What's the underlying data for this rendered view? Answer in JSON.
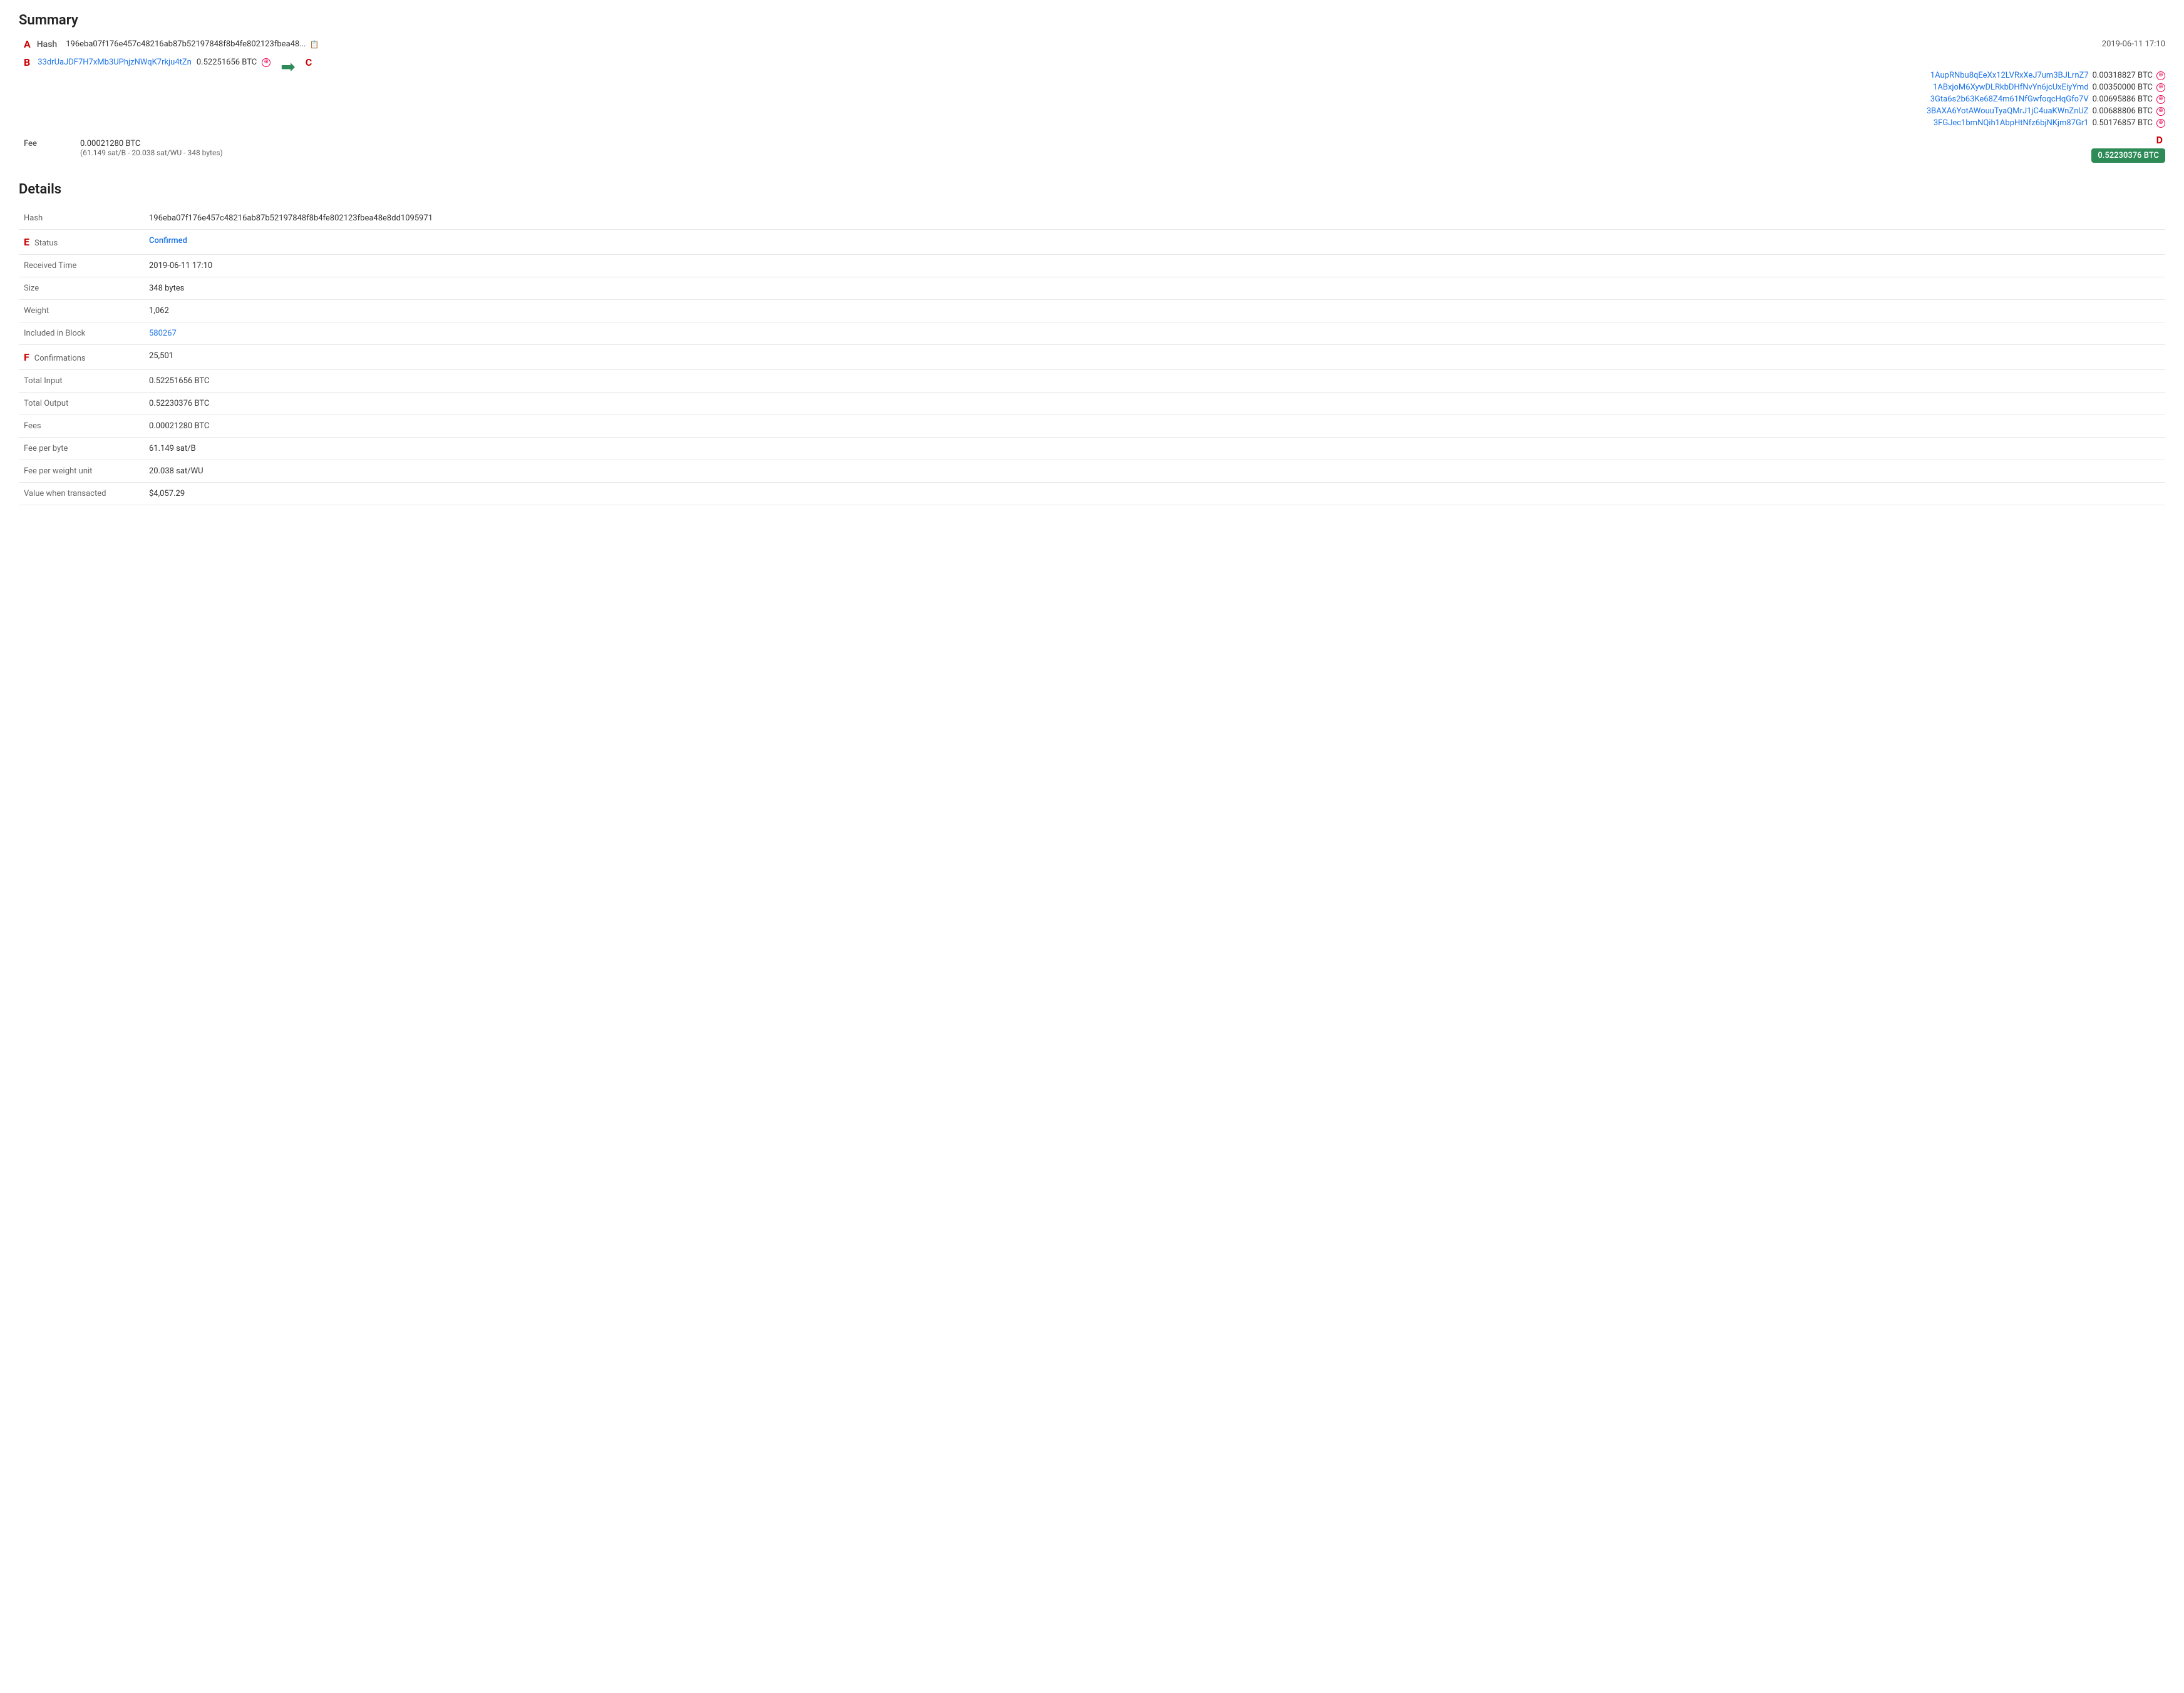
{
  "page": {
    "summary_title": "Summary",
    "details_title": "Details",
    "labels": {
      "A": "A",
      "B": "B",
      "C": "C",
      "D": "D",
      "E": "E",
      "F": "F"
    }
  },
  "summary": {
    "hash_label": "Hash",
    "hash_short": "196eba07f176e457c48216ab87b52197848f8b4fe802123fbea48...",
    "timestamp": "2019-06-11 17:10",
    "input_address": "33drUaJDF7H7xMb3UPhjzNWqK7rkju4tZn",
    "input_amount": "0.52251656 BTC",
    "outputs": [
      {
        "address": "1AupRNbu8qEeXx12LVRxXeJ7um3BJLrnZ7",
        "amount": "0.00318827 BTC"
      },
      {
        "address": "1ABxjoM6XywDLRkbDHfNvYn6jcUxEiyYmd",
        "amount": "0.00350000 BTC"
      },
      {
        "address": "3Gta6s2b63Ke68Z4m61NfGwfoqcHqGfo7V",
        "amount": "0.00695886 BTC"
      },
      {
        "address": "3BAXA6YotAWouuTyaQMrJ1jC4uaKWnZnUZ",
        "amount": "0.00688806 BTC"
      },
      {
        "address": "3FGJec1bmNQih1AbpHtNfz6bjNKjm87Gr1",
        "amount": "0.50176857 BTC"
      }
    ],
    "fee_label": "Fee",
    "fee_value": "0.00021280 BTC",
    "fee_detail": "(61.149 sat/B - 20.038 sat/WU - 348 bytes)",
    "total_output": "0.52230376 BTC"
  },
  "details": {
    "rows": [
      {
        "label": "Hash",
        "value": "196eba07f176e457c48216ab87b52197848f8b4fe802123fbea48e8dd1095971",
        "type": "text"
      },
      {
        "label": "Status",
        "value": "Confirmed",
        "type": "status"
      },
      {
        "label": "Received Time",
        "value": "2019-06-11 17:10",
        "type": "text"
      },
      {
        "label": "Size",
        "value": "348 bytes",
        "type": "text"
      },
      {
        "label": "Weight",
        "value": "1,062",
        "type": "text"
      },
      {
        "label": "Included in Block",
        "value": "580267",
        "type": "link"
      },
      {
        "label": "Confirmations",
        "value": "25,501",
        "type": "text"
      },
      {
        "label": "Total Input",
        "value": "0.52251656 BTC",
        "type": "text"
      },
      {
        "label": "Total Output",
        "value": "0.52230376 BTC",
        "type": "text"
      },
      {
        "label": "Fees",
        "value": "0.00021280 BTC",
        "type": "text"
      },
      {
        "label": "Fee per byte",
        "value": "61.149 sat/B",
        "type": "text"
      },
      {
        "label": "Fee per weight unit",
        "value": "20.038 sat/WU",
        "type": "text"
      },
      {
        "label": "Value when transacted",
        "value": "$4,057.29",
        "type": "text"
      }
    ]
  }
}
